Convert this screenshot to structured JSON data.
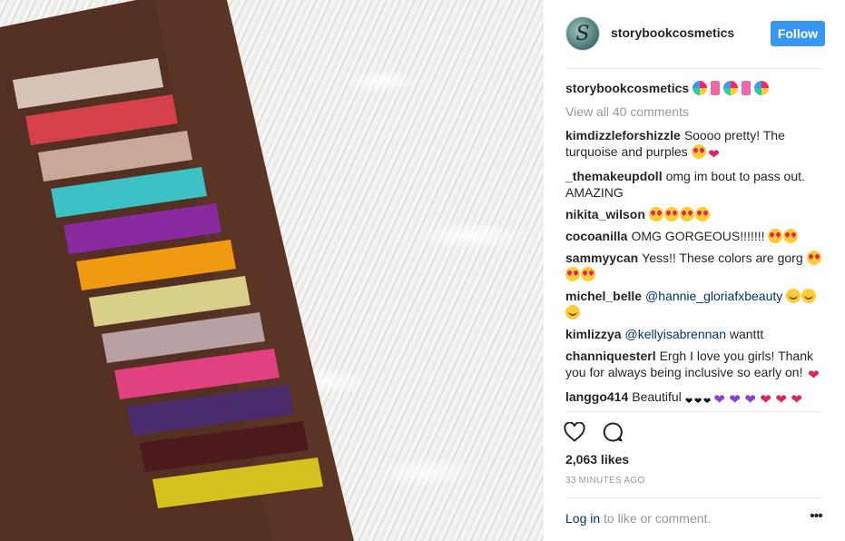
{
  "post": {
    "username": "storybookcosmetics",
    "follow_label": "Follow",
    "avatar_letter": "S",
    "caption_user": "storybookcosmetics",
    "view_all": "View all 40 comments",
    "likes": "2,063 likes",
    "time": "33 MINUTES AGO",
    "login_link": "Log in",
    "login_rest": " to like or comment.",
    "more_label": "•••"
  },
  "comments": [
    {
      "user": "kimdizzleforshizzle",
      "text": "Soooo pretty! The turquoise and purples",
      "emoji": [
        "heart-eyes",
        "heart"
      ]
    },
    {
      "user": "_themakeupdoll",
      "text": "omg im bout to pass out. AMAZING",
      "emoji": []
    },
    {
      "user": "nikita_wilson",
      "text": "",
      "emoji": [
        "heart-eyes",
        "heart-eyes",
        "heart-eyes",
        "heart-eyes"
      ]
    },
    {
      "user": "cocoanilla",
      "text": "OMG GORGEOUS!!!!!!!",
      "emoji": [
        "heart-eyes",
        "heart-eyes"
      ]
    },
    {
      "user": "sammyycan",
      "text": "Yess!! These colors are gorg",
      "emoji": [
        "heart-eyes",
        "heart-eyes",
        "heart-eyes"
      ]
    },
    {
      "user": "michel_belle",
      "mention": "@hannie_gloriafxbeauty",
      "text": "",
      "emoji": [
        "relieved",
        "relieved",
        "relieved"
      ]
    },
    {
      "user": "kimlizzya",
      "mention": "@kellyisabrennan",
      "text": "wanttt",
      "emoji": []
    },
    {
      "user": "channiquesterl",
      "text": "Ergh I love you girls! Thank you for always being inclusive so early on!",
      "emoji": [
        "heart"
      ]
    },
    {
      "user": "langgo414",
      "text": "Beautiful",
      "emoji": [
        "black",
        "black",
        "black",
        "purple",
        "purple",
        "purple",
        "heart",
        "heart",
        "heart"
      ]
    }
  ],
  "caption_emoji": [
    "lolly",
    "candy",
    "lolly",
    "candy",
    "lolly"
  ],
  "swatches": [
    {
      "name": "champagne",
      "color": "#d8c3b7"
    },
    {
      "name": "red",
      "color": "#d6404a"
    },
    {
      "name": "nude",
      "color": "#c9a898"
    },
    {
      "name": "turquoise",
      "color": "#3cc2c4"
    },
    {
      "name": "purple",
      "color": "#8a2aa0"
    },
    {
      "name": "orange",
      "color": "#ef9a10"
    },
    {
      "name": "pale-yellow",
      "color": "#d9d08a"
    },
    {
      "name": "mauve",
      "color": "#b8a0a4"
    },
    {
      "name": "pink",
      "color": "#e2417f"
    },
    {
      "name": "deep-violet",
      "color": "#4a2c6e"
    },
    {
      "name": "burgundy",
      "color": "#4a1a1c"
    },
    {
      "name": "gold",
      "color": "#d6c21e"
    }
  ],
  "colors": {
    "skin": "#5a3424",
    "follow_button": "#3897f0",
    "link": "#003569"
  }
}
